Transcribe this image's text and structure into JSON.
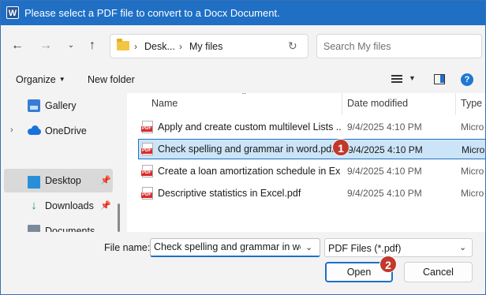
{
  "window": {
    "title": "Please select a PDF file to convert to a Docx Document.",
    "app_icon_letter": "W"
  },
  "navigation": {
    "back_icon": "arrow-left-icon",
    "forward_icon": "arrow-right-icon",
    "recent_icon": "chevron-down-icon",
    "up_icon": "arrow-up-icon",
    "breadcrumb": [
      "Desk...",
      "My files"
    ],
    "search_placeholder": "Search My files"
  },
  "toolbar": {
    "organize_label": "Organize",
    "new_folder_label": "New folder",
    "help_label": "?"
  },
  "sidebar": {
    "items": [
      {
        "label": "Gallery",
        "icon": "gallery-icon"
      },
      {
        "label": "OneDrive",
        "icon": "onedrive-icon"
      },
      {
        "label": "Desktop",
        "icon": "desktop-icon",
        "selected": true
      },
      {
        "label": "Downloads",
        "icon": "downloads-icon"
      },
      {
        "label": "Documents",
        "icon": "documents-icon"
      }
    ]
  },
  "file_list": {
    "columns": [
      "Name",
      "Date modified",
      "Type"
    ],
    "rows": [
      {
        "name": "Apply and create custom multilevel Lists ...",
        "date": "9/4/2025 4:10 PM",
        "type": "Micro"
      },
      {
        "name": "Check spelling and grammar in word.pdf",
        "date": "9/4/2025 4:10 PM",
        "type": "Micro",
        "selected": true
      },
      {
        "name": "Create a loan amortization schedule in Ex...",
        "date": "9/4/2025 4:10 PM",
        "type": "Micro"
      },
      {
        "name": "Descriptive statistics in Excel.pdf",
        "date": "9/4/2025 4:10 PM",
        "type": "Micro"
      }
    ]
  },
  "bottom": {
    "file_name_label": "File name:",
    "file_name_value": "Check spelling and grammar in wo",
    "file_type_value": "PDF Files  (*.pdf)",
    "open_label": "Open",
    "cancel_label": "Cancel"
  },
  "badges": [
    "1",
    "2"
  ],
  "colors": {
    "title_bar": "#1f6fc5",
    "selection": "#cce4f7",
    "badge": "#c0392b"
  }
}
